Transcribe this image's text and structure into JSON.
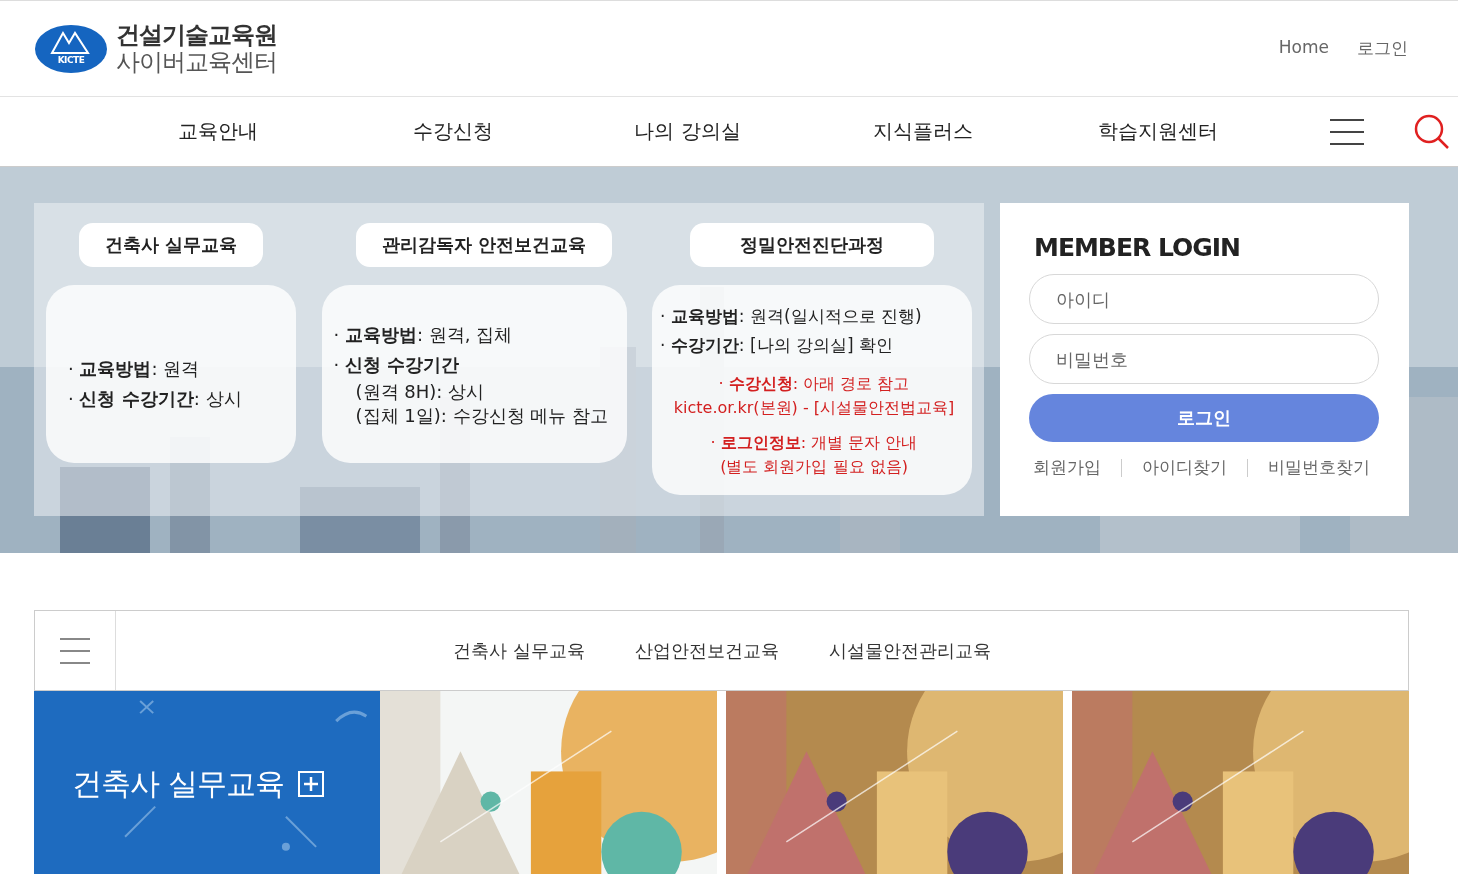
{
  "header": {
    "logo_title": "건설기술교육원",
    "logo_subtitle": "사이버교육센터",
    "logo_badge": "KICTE",
    "links": [
      "Home",
      "로그인"
    ]
  },
  "nav": {
    "items": [
      "교육안내",
      "수강신청",
      "나의 강의실",
      "지식플러스",
      "학습지원센터"
    ]
  },
  "banner": {
    "courses": [
      {
        "title": "건축사 실무교육",
        "lines": [
          {
            "kind": "bullet",
            "text": "·  **교육방법**: 원격"
          },
          {
            "kind": "bullet",
            "text": "·  **신청 수강기간**: 상시"
          }
        ]
      },
      {
        "title": "관리감독자 안전보건교육",
        "lines": [
          {
            "kind": "bullet",
            "text": "·  **교육방법**: 원격, 집체"
          },
          {
            "kind": "bullet",
            "text": "·  **신청 수강기간**"
          },
          {
            "kind": "sub",
            "text": "(원격 8H): 상시"
          },
          {
            "kind": "sub",
            "text": "(집체 1일): 수강신청 메뉴 참고"
          }
        ]
      },
      {
        "title": "정밀안전진단과정",
        "lines": [
          {
            "kind": "bullet",
            "text": "·  **교육방법**: 원격(일시적으로 진행)"
          },
          {
            "kind": "bullet",
            "text": "·  **수강기간**: [나의 강의실] 확인"
          },
          {
            "kind": "notice",
            "text": "·  **수강신청**: 아래 경로 참고"
          },
          {
            "kind": "notesub",
            "text": "kicte.or.kr(본원) - [시설물안전법교육]"
          },
          {
            "kind": "notice",
            "text": "·  **로그인정보**: 개별 문자 안내"
          },
          {
            "kind": "notesub",
            "text": "(별도 회원가입 필요 없음)"
          }
        ]
      }
    ]
  },
  "login": {
    "title": "MEMBER LOGIN",
    "id_placeholder": "아이디",
    "password_placeholder": "비밀번호",
    "button": "로그인",
    "links": [
      "회원가입",
      "아이디찾기",
      "비밀번호찾기"
    ]
  },
  "courses": {
    "tabs": [
      "건축사 실무교육",
      "산업안전보건교육",
      "시설물안전관리교육"
    ],
    "tiles": [
      {
        "kind": "category",
        "title": "건축사 실무교육"
      },
      {
        "kind": "picture"
      },
      {
        "kind": "picture"
      },
      {
        "kind": "picture"
      }
    ]
  }
}
